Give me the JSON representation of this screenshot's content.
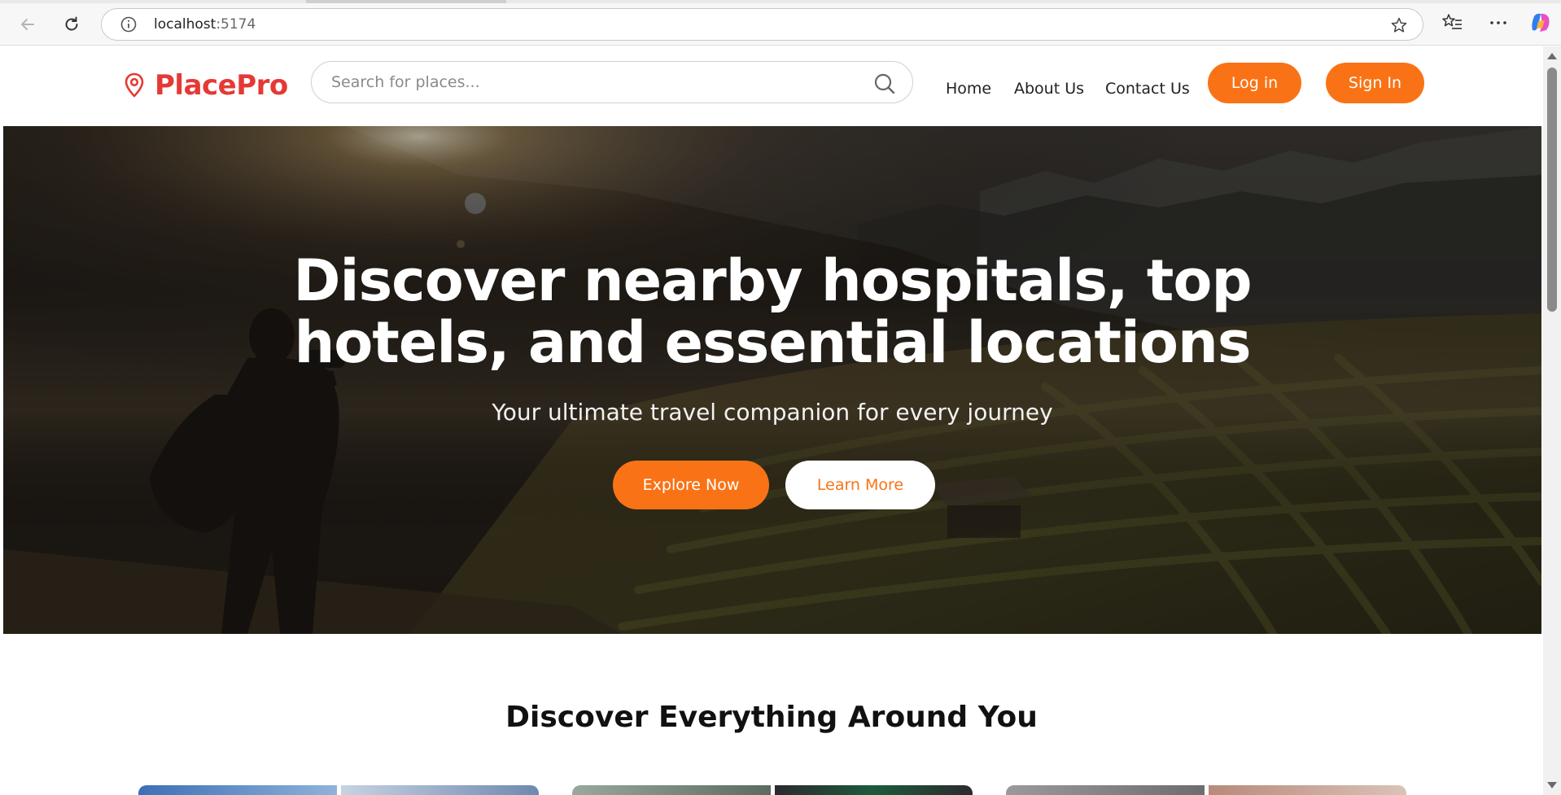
{
  "browser": {
    "url_host": "localhost",
    "url_port": ":5174"
  },
  "header": {
    "brand": "PlacePro",
    "search_placeholder": "Search for places...",
    "nav": {
      "home": "Home",
      "about": "About Us",
      "contact": "Contact Us"
    },
    "login_label": "Log in",
    "signin_label": "Sign In"
  },
  "hero": {
    "title": "Discover nearby hospitals, top hotels, and essential locations",
    "subtitle": "Your ultimate travel companion for every journey",
    "explore_label": "Explore Now",
    "learn_label": "Learn More"
  },
  "discover": {
    "title": "Discover Everything Around You"
  },
  "colors": {
    "accent": "#f97316",
    "brand": "#e53935"
  },
  "icons": {
    "back": "arrow-left-icon",
    "reload": "reload-icon",
    "info": "info-icon",
    "favorite": "star-icon",
    "favorites_list": "favorites-list-icon",
    "more": "more-icon",
    "copilot": "copilot-icon",
    "logo": "map-pin-icon",
    "search": "search-icon"
  }
}
